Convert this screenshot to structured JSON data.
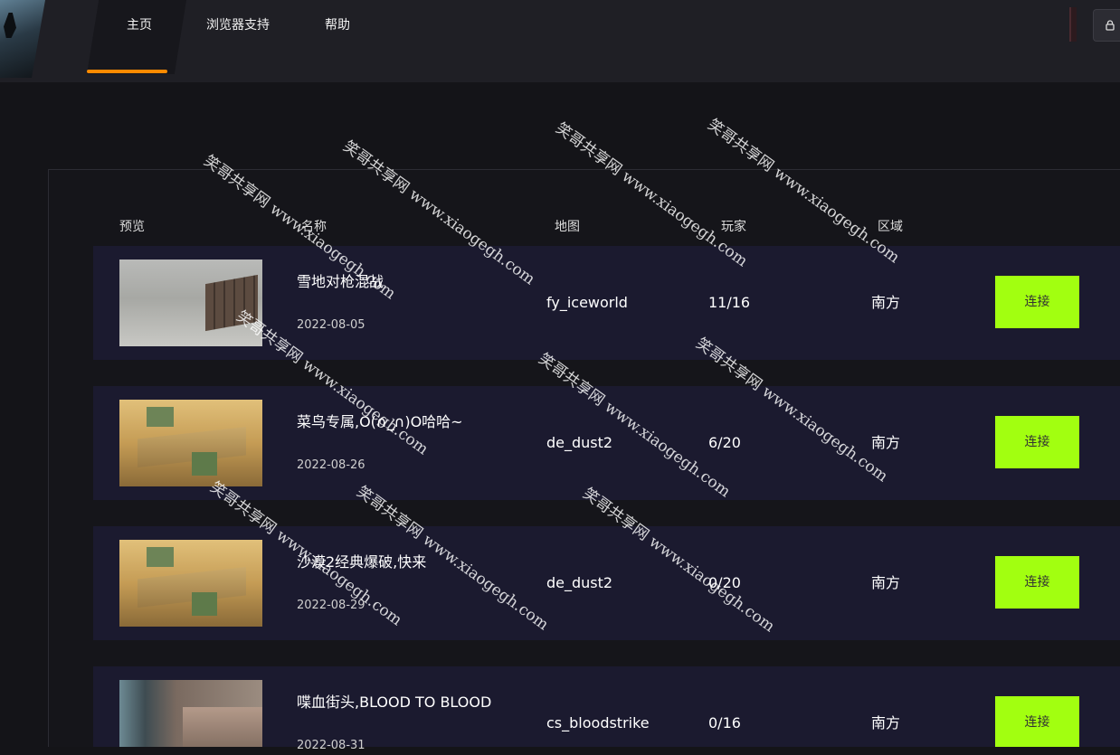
{
  "nav": {
    "items": [
      {
        "label": "主页",
        "active": true
      },
      {
        "label": "浏览器支持",
        "active": false
      },
      {
        "label": "帮助",
        "active": false
      }
    ],
    "accent_color": "#ff8a00"
  },
  "header": {
    "user_icon": "lock-icon"
  },
  "table": {
    "headers": {
      "preview": "预览",
      "name": "名称",
      "map": "地图",
      "players": "玩家",
      "region": "区域"
    },
    "rows": [
      {
        "name": "雪地对枪混战",
        "date": "2022-08-05",
        "map": "fy_iceworld",
        "players": "11/16",
        "region": "南方",
        "action": "连接"
      },
      {
        "name": "菜鸟专属,O(∩_∩)O哈哈~",
        "date": "2022-08-26",
        "map": "de_dust2",
        "players": "6/20",
        "region": "南方",
        "action": "连接"
      },
      {
        "name": "沙漠2经典爆破,快来",
        "date": "2022-08-29",
        "map": "de_dust2",
        "players": "0/20",
        "region": "南方",
        "action": "连接"
      },
      {
        "name": "喋血街头,BLOOD TO BLOOD",
        "date": "2022-08-31",
        "map": "cs_bloodstrike",
        "players": "0/16",
        "region": "南方",
        "action": "连接"
      }
    ],
    "button_color": "#a2ff10",
    "row_color": "#1b1a2f"
  },
  "watermark": {
    "text": "笑哥共享网 www.xiaogegh.com"
  }
}
